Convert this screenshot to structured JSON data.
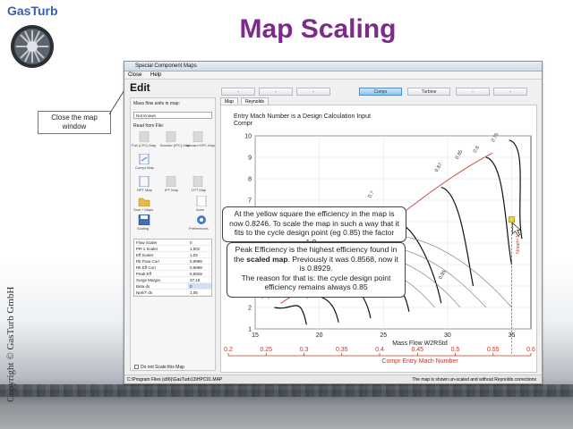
{
  "slide": {
    "logo_text": "GasTurb",
    "title": "Map Scaling",
    "copyright": "Copyright © GasTurb GmbH",
    "close_callout": "Close the map window",
    "yellow_callout": "At the yellow square the efficiency in the map is now 0.8246. To scale the map in such a way that it fits to the cycle design point (eg 0.85) the factor 1.0...",
    "peak_callout_parts": {
      "p1": "Peak Efficiency is the highest efficiency found in the ",
      "b1": "scaled map",
      "p2": ". Previously it was 0.8568, now it is 0.8929.",
      "p3": "The reason for that is: the cycle design point efficiency remains always 0.85"
    }
  },
  "window": {
    "title": "Special Component Maps",
    "menu": [
      "Close",
      "Help"
    ],
    "edit_label": "Edit",
    "toolbar_buttons": [
      "-",
      "-",
      "-",
      "Compr",
      "Turbine",
      "-",
      "-"
    ],
    "active_button": "Compr",
    "left_panel": {
      "mass_flow_label": "Mass flow units in map:",
      "mass_flow_value": "Not Known",
      "read_from_file": "Read from File:",
      "file_buttons": [
        "Fan (LPC) Map",
        "Booster (IPC) Map",
        "Inboard HPC Map"
      ],
      "compr_map": "Compr Map",
      "hpt_row": [
        "HPT Map",
        "IPT Map",
        "LPT Map"
      ],
      "scal_maps": "Scal + Maps",
      "axes": "Axes",
      "scaling": "Scaling",
      "preferences": "Preferences",
      "scaling_table": [
        {
          "k": "Flow Scaler",
          "v": "0"
        },
        {
          "k": "PR-1 Scaler",
          "v": "1,501"
        },
        {
          "k": "Eff Scaler",
          "v": "1,03"
        },
        {
          "k": "Rlt Flow Corr",
          "v": "0,9999"
        },
        {
          "k": "Rlt Eff Corr",
          "v": "0,9999"
        },
        {
          "k": "Peak Eff",
          "v": "0,8929"
        },
        {
          "k": "Surge Margin",
          "v": "37,16"
        },
        {
          "k": "Beta ds",
          "v": "0"
        },
        {
          "k": "Nrel/T ds",
          "v": "1,05"
        }
      ],
      "no_scale_checkbox": "Do not Scale this Map"
    },
    "tabs": [
      "Map",
      "Reynolds"
    ],
    "status_left": "C:\\Program Files (x86)\\GasTurb13\\HPC01.MAP",
    "status_right": "The map is shown un-scaled and without Reynolds corrections"
  },
  "chart_data": {
    "type": "line",
    "title": "Entry Mach Number is a Design Calculation Input",
    "subtitle": "Compr",
    "xlabel": "Mass Flow W2RStd",
    "x_ticks": [
      "15",
      "20",
      "25",
      "30",
      "35"
    ],
    "xlim": [
      15,
      36.5
    ],
    "ylabel": "",
    "y_ticks": [
      "10",
      "9",
      "8",
      "7",
      "6",
      "5",
      "4",
      "3",
      "2",
      "1"
    ],
    "ylim": [
      1,
      10
    ],
    "secondary_xlabel": "Compr Entry Mach Number",
    "secondary_x_ticks": [
      "0.2",
      "0.25",
      "0.3",
      "0.35",
      "0.4",
      "0.45",
      "0.5",
      "0.55",
      "0.6"
    ],
    "efficiency_labels": [
      "0.87",
      "0.85",
      "0.8",
      "0.75",
      "0.7",
      "0.65",
      "0.9",
      "0.95"
    ],
    "speed_label": "N/sqrt=1.05",
    "design_point": {
      "x": 35,
      "y": 6.1
    }
  }
}
